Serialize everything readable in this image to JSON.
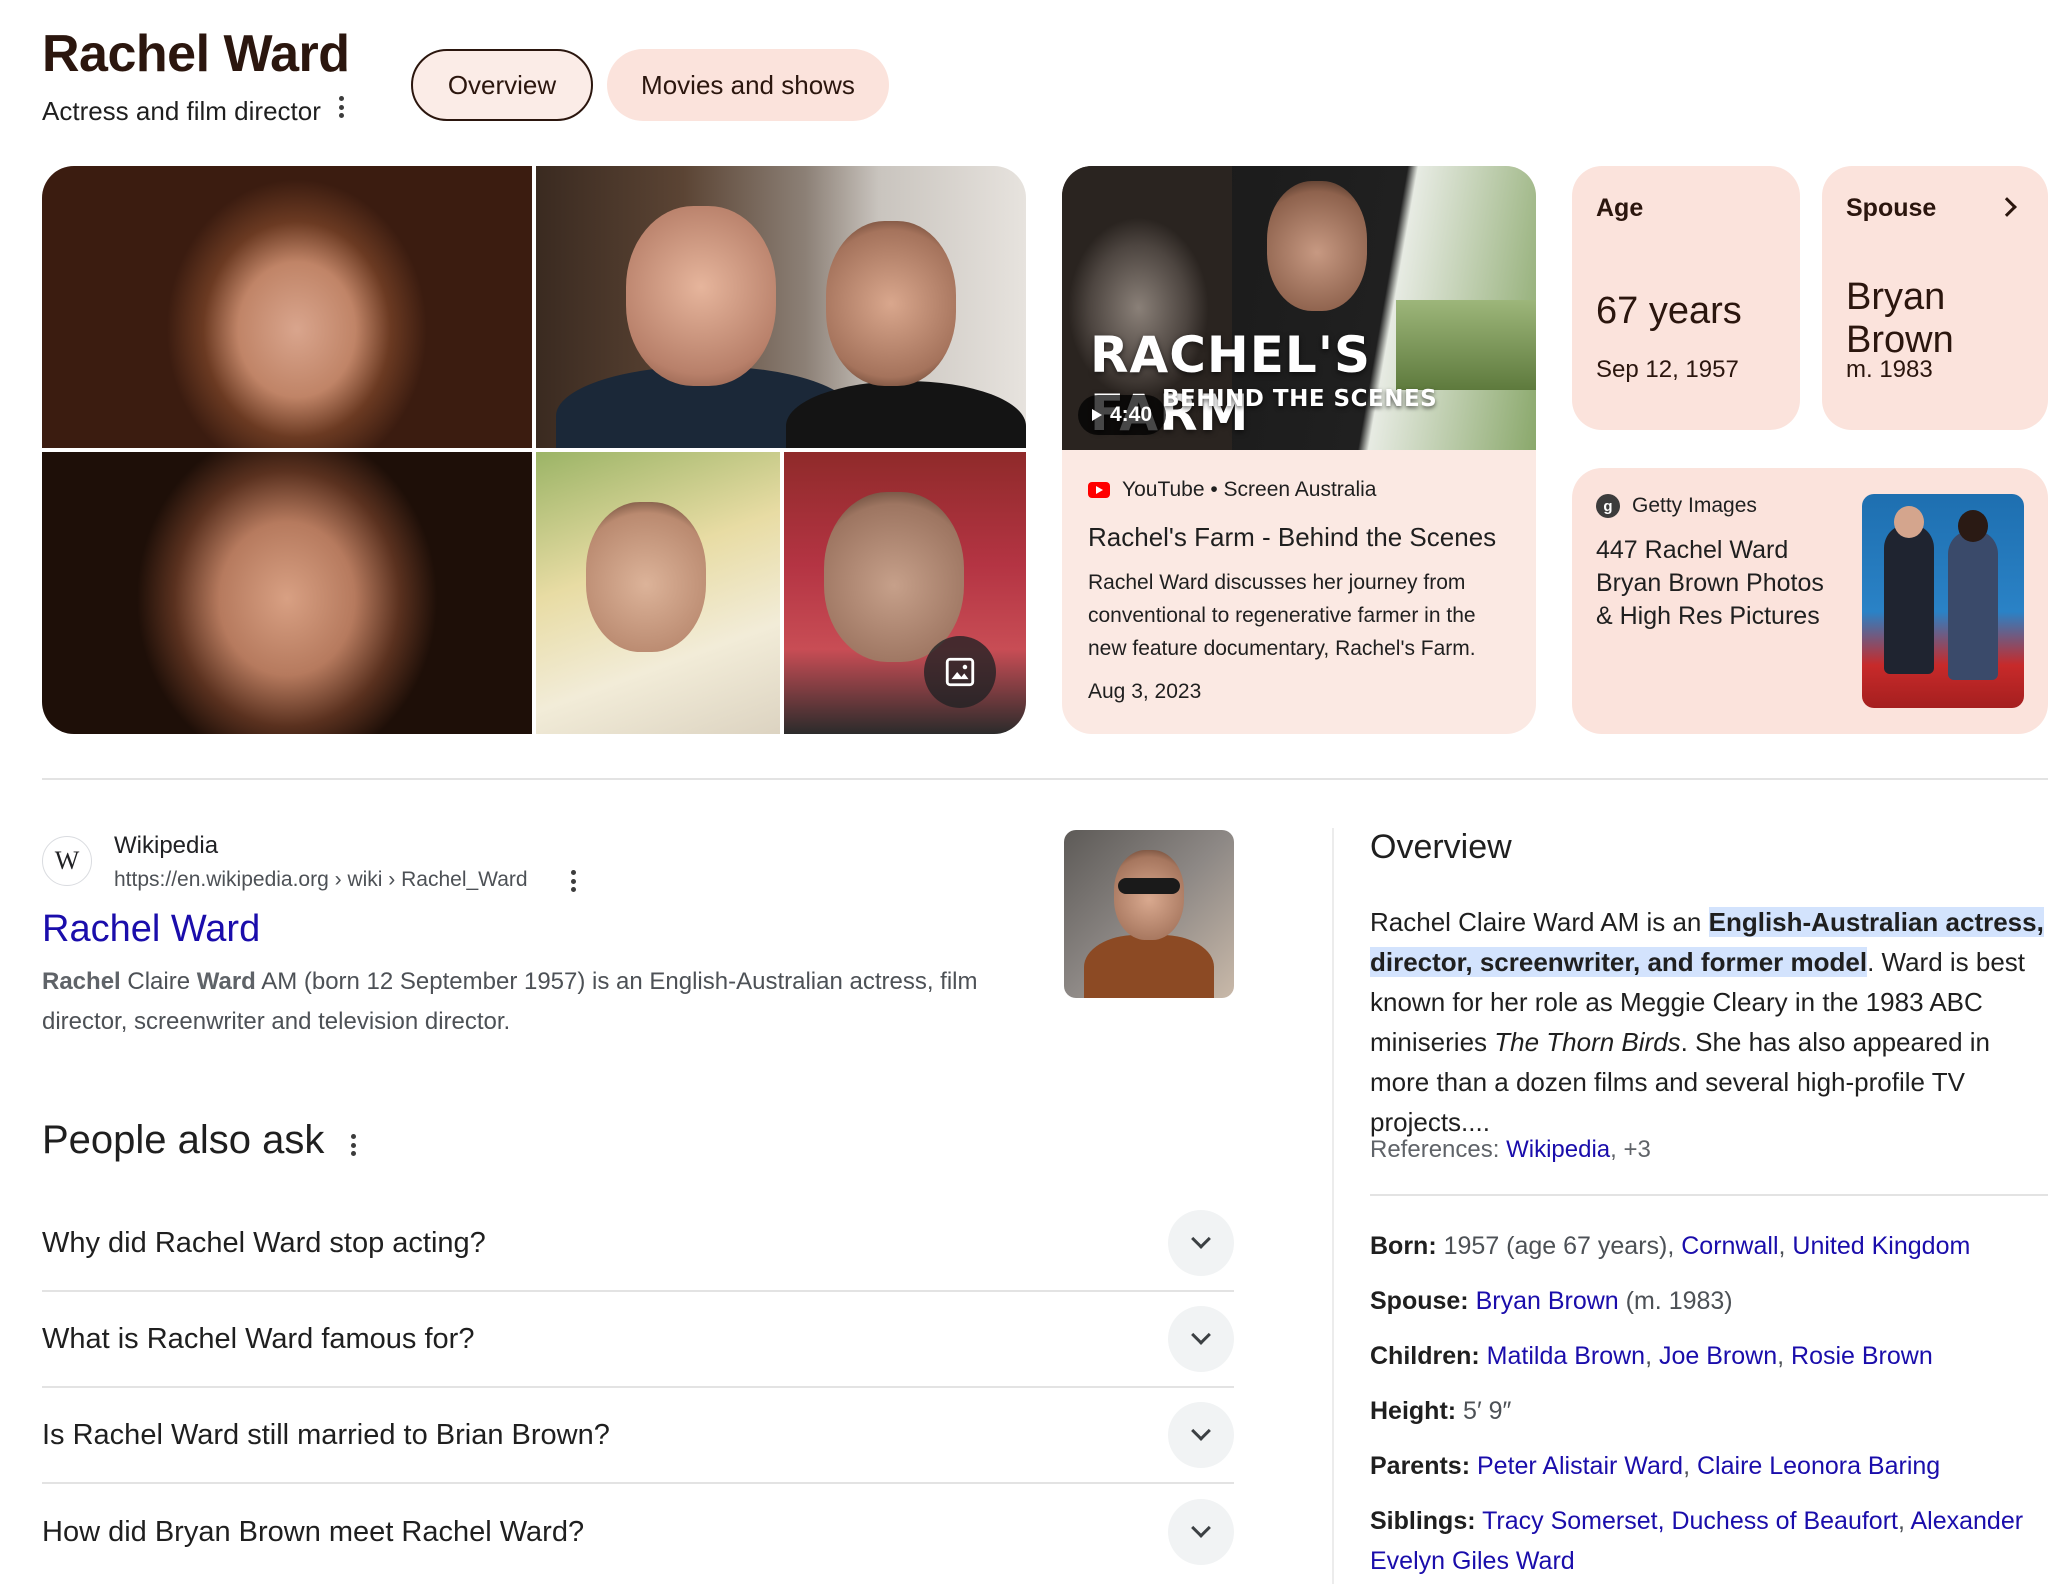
{
  "header": {
    "title": "Rachel Ward",
    "subtitle": "Actress and film director",
    "tabs": [
      {
        "label": "Overview",
        "selected": true
      },
      {
        "label": "Movies and shows",
        "selected": false
      }
    ]
  },
  "video": {
    "thumb_title": "RACHEL'S FARM",
    "thumb_subtitle": "BEHIND THE SCENES",
    "duration": "4:40",
    "source": "YouTube • Screen Australia",
    "title": "Rachel's Farm - Behind the Scenes",
    "description": "Rachel Ward discusses her journey from conventional to regenerative farmer in the new feature documentary, Rachel's Farm.",
    "date": "Aug 3, 2023"
  },
  "facts": {
    "age": {
      "label": "Age",
      "value": "67 years",
      "detail": "Sep 12, 1957"
    },
    "spouse": {
      "label": "Spouse",
      "value": "Bryan Brown",
      "detail": "m. 1983"
    }
  },
  "getty": {
    "source": "Getty Images",
    "title": "447 Rachel Ward Bryan Brown Photos & High Res Pictures"
  },
  "wiki": {
    "site": "Wikipedia",
    "url": "https://en.wikipedia.org › wiki › Rachel_Ward",
    "title": "Rachel Ward",
    "snippet_parts": [
      "Rachel",
      " Claire ",
      "Ward",
      " AM (born 12 September 1957) is an English-Australian actress, film director, screenwriter and television director."
    ]
  },
  "paa": {
    "title": "People also ask",
    "questions": [
      "Why did Rachel Ward stop acting?",
      "What is Rachel Ward famous for?",
      "Is Rachel Ward still married to Brian Brown?",
      "How did Bryan Brown meet Rachel Ward?"
    ]
  },
  "overview": {
    "title": "Overview",
    "body_pre": "Rachel Claire Ward AM is an ",
    "body_highlight": "English-Australian actress, director, screenwriter, and former model",
    "body_mid": ". Ward is best known for her role as Meggie Cleary in the 1983 ABC miniseries ",
    "body_italic": "The Thorn Birds",
    "body_post": ". She has also appeared in more than a dozen films and several high-profile TV projects....",
    "refs_label": "References: ",
    "refs_link": "Wikipedia",
    "refs_more": ", +3",
    "born_label": "Born:",
    "born_text": " 1957 (age 67 years), ",
    "born_place1": "Cornwall",
    "born_place2": "United Kingdom",
    "spouse_label": "Spouse:",
    "spouse_link": "Bryan Brown",
    "spouse_text": " (m. 1983)",
    "children_label": "Children:",
    "children": [
      "Matilda Brown",
      "Joe Brown",
      "Rosie Brown"
    ],
    "height_label": "Height:",
    "height_text": " 5′ 9″",
    "parents_label": "Parents:",
    "parents": [
      "Peter Alistair Ward",
      "Claire Leonora Baring"
    ],
    "siblings_label": "Siblings:",
    "siblings": [
      "Tracy Somerset, Duchess of Beaufort",
      "Alexander Evelyn Giles Ward"
    ]
  },
  "icons": {
    "gallery": "image-gallery-icon",
    "kebab": "more-vert-icon",
    "chevron": "chevron-down-icon"
  },
  "colors": {
    "accent_bg": "#fbe3dc",
    "title_brown": "#2b160e",
    "link": "#1a0dab",
    "highlight": "#d3e3fd"
  }
}
